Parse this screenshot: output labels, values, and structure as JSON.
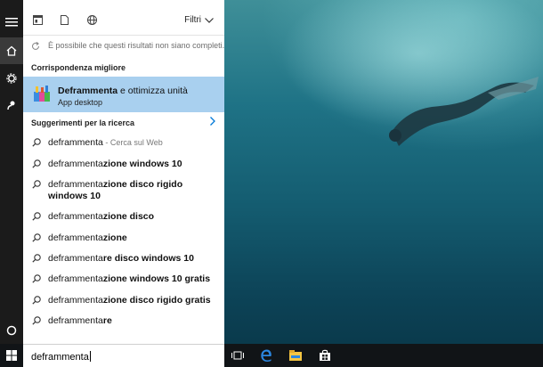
{
  "search": {
    "query": "deframmenta",
    "filters_label": "Filtri",
    "results_note": "È possibile che questi risultati non siano completi..."
  },
  "best_match": {
    "heading": "Corrispondenza migliore",
    "app_name_bold": "Deframmenta",
    "app_name_rest": " e ottimizza unità",
    "app_type": "App desktop"
  },
  "suggestions": {
    "heading": "Suggerimenti per la ricerca",
    "items": [
      {
        "typed": "deframmenta",
        "rest": "",
        "web": " - Cerca sul Web"
      },
      {
        "typed": "deframmenta",
        "rest": "zione windows 10",
        "web": ""
      },
      {
        "typed": "deframmenta",
        "rest": "zione disco rigido windows 10",
        "web": ""
      },
      {
        "typed": "deframmenta",
        "rest": "zione disco",
        "web": ""
      },
      {
        "typed": "deframmenta",
        "rest": "zione",
        "web": ""
      },
      {
        "typed": "deframmenta",
        "rest": "re disco windows 10",
        "web": ""
      },
      {
        "typed": "deframmenta",
        "rest": "zione windows 10 gratis",
        "web": ""
      },
      {
        "typed": "deframmenta",
        "rest": "zione disco rigido gratis",
        "web": ""
      },
      {
        "typed": "deframmenta",
        "rest": "re",
        "web": ""
      }
    ]
  },
  "rail_icons": [
    "hamburger-icon",
    "home-icon",
    "gear-icon",
    "feedback-icon",
    "cortana-icon",
    "windows-icon"
  ],
  "taskbar_icons": [
    "task-view-icon",
    "edge-icon",
    "file-explorer-icon",
    "store-icon"
  ],
  "colors": {
    "accent": "#0078d7",
    "selection": "#a9d0ef",
    "rail": "#1b1b1b",
    "taskbar": "#111417"
  }
}
